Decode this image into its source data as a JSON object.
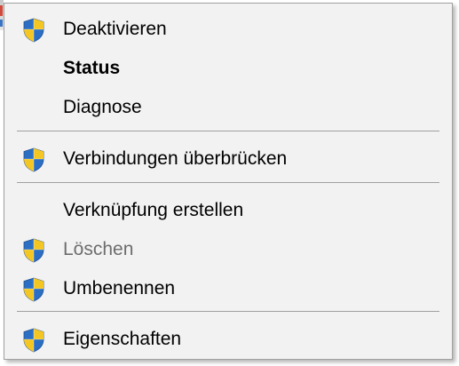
{
  "context_menu": {
    "items": [
      {
        "label": "Deaktivieren",
        "shield": true,
        "bold": false,
        "disabled": false
      },
      {
        "label": "Status",
        "shield": false,
        "bold": true,
        "disabled": false
      },
      {
        "label": "Diagnose",
        "shield": false,
        "bold": false,
        "disabled": false
      },
      {
        "label": "Verbindungen überbrücken",
        "shield": true,
        "bold": false,
        "disabled": false
      },
      {
        "label": "Verknüpfung erstellen",
        "shield": false,
        "bold": false,
        "disabled": false
      },
      {
        "label": "Löschen",
        "shield": true,
        "bold": false,
        "disabled": true
      },
      {
        "label": "Umbenennen",
        "shield": true,
        "bold": false,
        "disabled": false
      },
      {
        "label": "Eigenschaften",
        "shield": true,
        "bold": false,
        "disabled": false
      }
    ],
    "icon": "uac-shield-icon"
  },
  "colors": {
    "menu_background": "#f2f2f2",
    "separator": "#a0a0a0",
    "text": "#000000",
    "disabled_text": "#6d6d6d",
    "shield_blue": "#2b6fc4",
    "shield_yellow": "#f3c624"
  }
}
